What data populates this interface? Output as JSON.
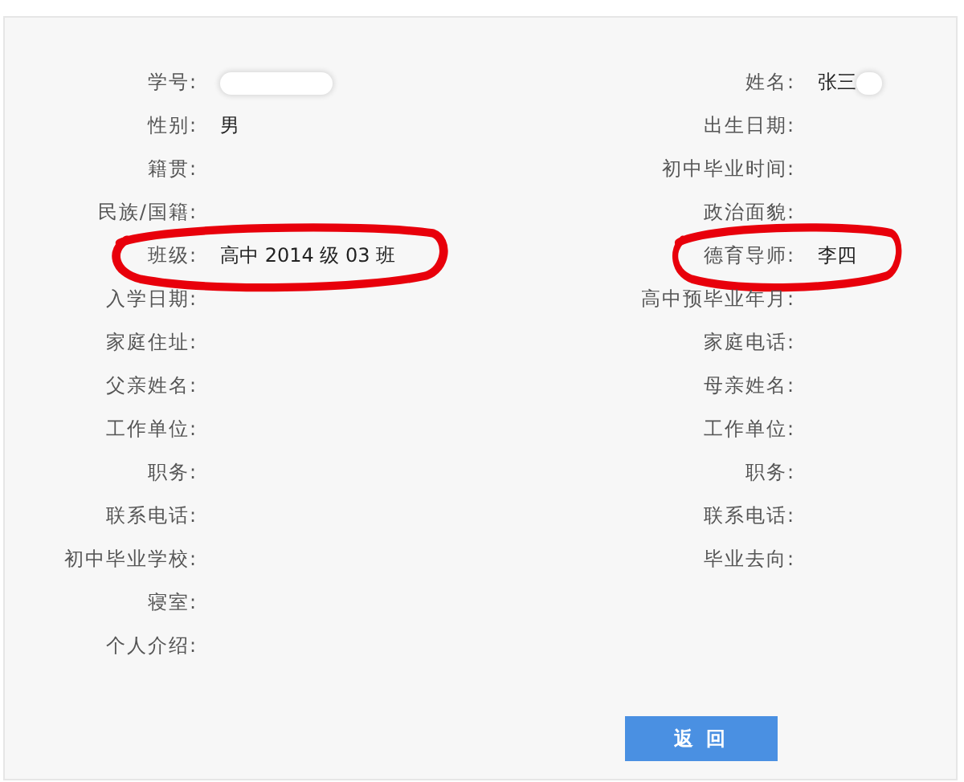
{
  "left_fields": [
    {
      "label": "学号:",
      "redacted": true
    },
    {
      "label": "性别:",
      "value": "男"
    },
    {
      "label": "籍贯:"
    },
    {
      "label": "民族/国籍:"
    },
    {
      "label": "班级:",
      "value": "高中 2014 级 03 班",
      "circled": true
    },
    {
      "label": "入学日期:"
    },
    {
      "label": "家庭住址:"
    },
    {
      "label": "父亲姓名:"
    },
    {
      "label": "工作单位:"
    },
    {
      "label": "职务:"
    },
    {
      "label": "联系电话:"
    },
    {
      "label": "初中毕业学校:"
    },
    {
      "label": "寝室:"
    },
    {
      "label": "个人介绍:"
    }
  ],
  "right_fields": [
    {
      "label": "姓名:",
      "value": "张三",
      "redacted": true
    },
    {
      "label": "出生日期:"
    },
    {
      "label": "初中毕业时间:"
    },
    {
      "label": "政治面貌:"
    },
    {
      "label": "德育导师:",
      "value": "李四",
      "circled": true
    },
    {
      "label": "高中预毕业年月:"
    },
    {
      "label": "家庭电话:"
    },
    {
      "label": "母亲姓名:"
    },
    {
      "label": "工作单位:"
    },
    {
      "label": "职务:"
    },
    {
      "label": "联系电话:"
    },
    {
      "label": "毕业去向:"
    }
  ],
  "buttons": [
    {
      "label": "返 回"
    }
  ]
}
